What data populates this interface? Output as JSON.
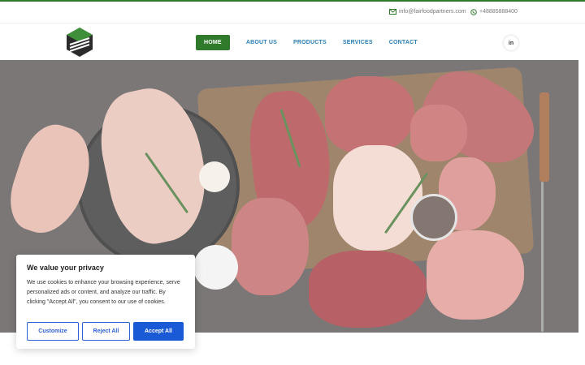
{
  "topbar": {
    "email": "info@fairfoodpartners.com",
    "phone": "+48885888400",
    "email_icon": "envelope-icon",
    "phone_icon": "whatsapp-icon"
  },
  "nav": {
    "items": [
      {
        "label": "HOME",
        "active": true
      },
      {
        "label": "ABOUT US",
        "active": false
      },
      {
        "label": "PRODUCTS",
        "active": false
      },
      {
        "label": "SERVICES",
        "active": false
      },
      {
        "label": "CONTACT",
        "active": false
      }
    ],
    "social_label": "in",
    "social_icon": "linkedin-icon",
    "logo_icon": "hexagon-logo-icon"
  },
  "hero": {
    "image": "assorted raw meats on wooden board with herbs and spices"
  },
  "cookie": {
    "title": "We value your privacy",
    "text": "We use cookies to enhance your browsing experience, serve personalized ads or content, and analyze our traffic. By clicking \"Accept All\", you consent to our use of cookies.",
    "customize": "Customize",
    "reject": "Reject All",
    "accept": "Accept All"
  },
  "colors": {
    "brand_green": "#2f7a2b",
    "nav_blue": "#2a7fb6",
    "accept_blue": "#1a5ad6"
  }
}
